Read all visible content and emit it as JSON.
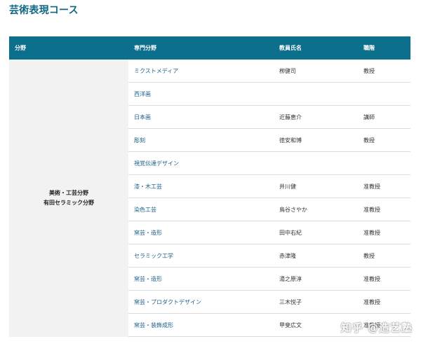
{
  "page": {
    "title": "芸術表現コース"
  },
  "table": {
    "headers": [
      "分野",
      "専門分野",
      "教員氏名",
      "職階"
    ],
    "field_lines": [
      "美術・工芸分野",
      "有田セラミック分野"
    ],
    "rows": [
      {
        "specialty": "ミクストメディア",
        "name": "栁健司",
        "rank": "教授"
      },
      {
        "specialty": "西洋画",
        "name": "",
        "rank": ""
      },
      {
        "specialty": "日本画",
        "name": "近藤恵介",
        "rank": "講師"
      },
      {
        "specialty": "彫刻",
        "name": "徳安和博",
        "rank": "教授"
      },
      {
        "specialty": "視覚伝達デザイン",
        "name": "",
        "rank": ""
      },
      {
        "specialty": "漆・木工芸",
        "name": "井川健",
        "rank": "准教授"
      },
      {
        "specialty": "染色工芸",
        "name": "鳥谷さやか",
        "rank": "准教授"
      },
      {
        "specialty": "窯芸・造形",
        "name": "田中右紀",
        "rank": "准教授"
      },
      {
        "specialty": "セラミック工学",
        "name": "赤津隆",
        "rank": "教授"
      },
      {
        "specialty": "窯芸・造形",
        "name": "湯之原淳",
        "rank": "准教授"
      },
      {
        "specialty": "窯芸・プロダクトデザイン",
        "name": "三木悦子",
        "rank": "准教授"
      },
      {
        "specialty": "窯芸・装飾成形",
        "name": "甲斐広文",
        "rank": "准教授"
      }
    ]
  },
  "watermark": "知乎 @造艺塾"
}
